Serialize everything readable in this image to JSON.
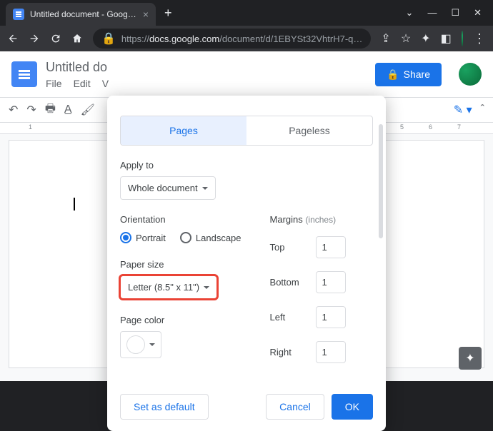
{
  "browser": {
    "tab_title": "Untitled document - Google Do…",
    "url_prefix": "https://",
    "url_host": "docs.google.com",
    "url_path": "/document/d/1EBYSt32VhtrH7-q…"
  },
  "docs": {
    "title": "Untitled do",
    "menus": [
      "File",
      "Edit",
      "V"
    ],
    "share": "Share",
    "ruler_marks": [
      "1",
      "5",
      "6",
      "7"
    ]
  },
  "dialog": {
    "tabs": {
      "pages": "Pages",
      "pageless": "Pageless"
    },
    "apply_to_label": "Apply to",
    "apply_to_value": "Whole document",
    "orientation_label": "Orientation",
    "orientation": {
      "portrait": "Portrait",
      "landscape": "Landscape"
    },
    "paper_size_label": "Paper size",
    "paper_size_value": "Letter (8.5\" x 11\")",
    "page_color_label": "Page color",
    "margins_label": "Margins",
    "margins_unit": "(inches)",
    "margins": {
      "top": {
        "label": "Top",
        "value": "1"
      },
      "bottom": {
        "label": "Bottom",
        "value": "1"
      },
      "left": {
        "label": "Left",
        "value": "1"
      },
      "right": {
        "label": "Right",
        "value": "1"
      }
    },
    "set_default": "Set as default",
    "cancel": "Cancel",
    "ok": "OK"
  }
}
